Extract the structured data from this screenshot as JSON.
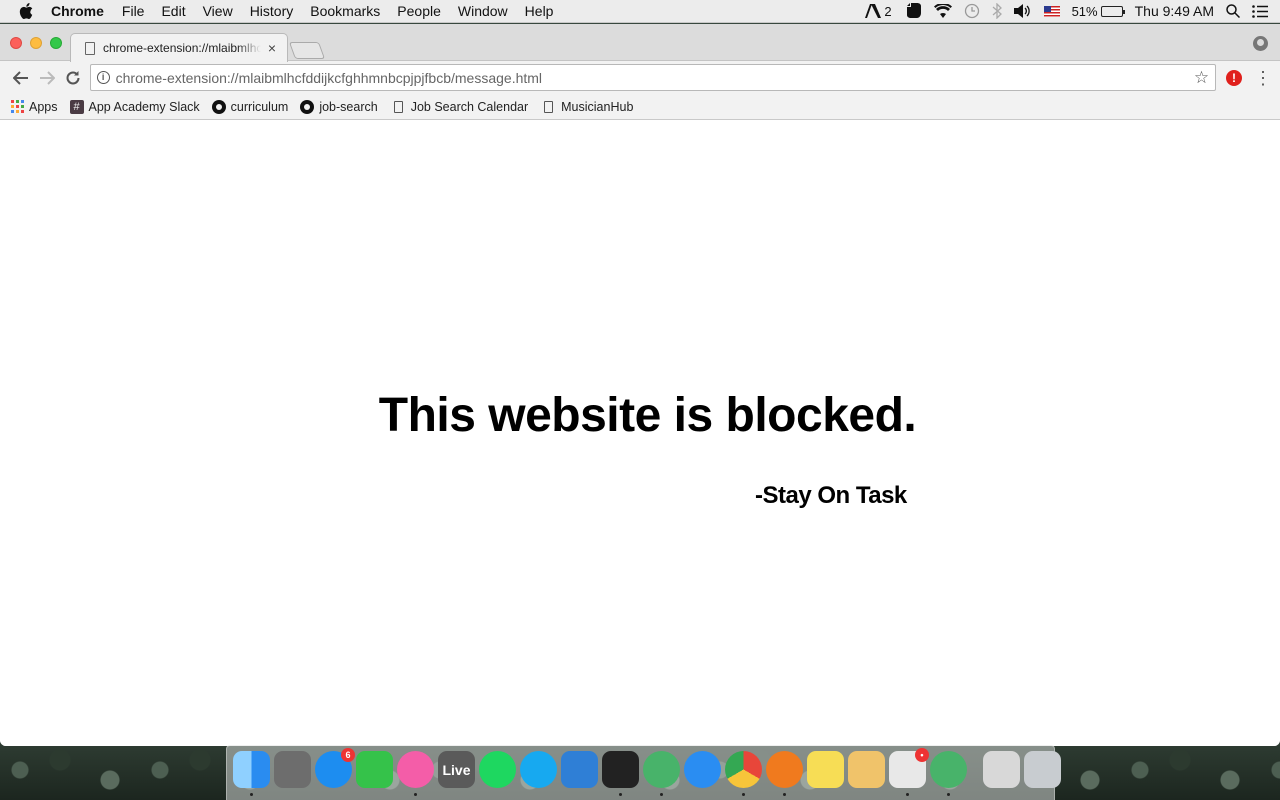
{
  "menubar": {
    "app_name": "Chrome",
    "items": [
      "File",
      "Edit",
      "View",
      "History",
      "Bookmarks",
      "People",
      "Window",
      "Help"
    ],
    "status": {
      "adobe_count": "2",
      "battery": "51%",
      "clock": "Thu 9:49 AM"
    }
  },
  "browser": {
    "tab_title": "chrome-extension://mlaibmlhcfddijkcfghhmnbcpjpjfbcb/message.html",
    "tab_close": "×",
    "url": "chrome-extension://mlaibmlhcfddijkcfghhmnbcpjpjfbcb/message.html",
    "extension_badge": "!",
    "bookmarks": [
      "Apps",
      "App Academy Slack",
      "curriculum",
      "job-search",
      "Job Search Calendar",
      "MusicianHub"
    ]
  },
  "page": {
    "heading": "This website is blocked.",
    "signature": "-Stay On Task"
  },
  "dock": {
    "apps": [
      {
        "name": "Finder",
        "color": "#2a8cf0",
        "running": true
      },
      {
        "name": "System Preferences",
        "color": "#6d6d6d",
        "running": false
      },
      {
        "name": "App Store",
        "color": "#1d8df0",
        "running": false,
        "badge": "6"
      },
      {
        "name": "FaceTime",
        "color": "#35c24a",
        "running": false
      },
      {
        "name": "iTunes",
        "color": "#f45da8",
        "running": true
      },
      {
        "name": "Live",
        "color": "#5a5a5a",
        "running": false,
        "label": "Live"
      },
      {
        "name": "Spotify",
        "color": "#1ed760",
        "running": false
      },
      {
        "name": "Skype",
        "color": "#17a9f0",
        "running": false
      },
      {
        "name": "Sequel Pro",
        "color": "#2f7fd6",
        "running": false
      },
      {
        "name": "Terminal",
        "color": "#222222",
        "running": true
      },
      {
        "name": "Atom",
        "color": "#48b36a",
        "running": true
      },
      {
        "name": "Safari",
        "color": "#2a8df2",
        "running": false
      },
      {
        "name": "Chrome",
        "color": "#e8463a",
        "running": true
      },
      {
        "name": "Firefox",
        "color": "#f07a1e",
        "running": true
      },
      {
        "name": "Notes",
        "color": "#f7dd55",
        "running": false
      },
      {
        "name": "TextEdit",
        "color": "#f0c36a",
        "running": false
      },
      {
        "name": "Slack",
        "color": "#e8e8e8",
        "running": true,
        "badge": "•"
      },
      {
        "name": "Atom Beta",
        "color": "#48b36a",
        "running": true
      },
      {
        "name": "Screenshot",
        "color": "#d8d8d8",
        "running": false
      },
      {
        "name": "Trash",
        "color": "#c8ccd0",
        "running": false
      }
    ]
  }
}
